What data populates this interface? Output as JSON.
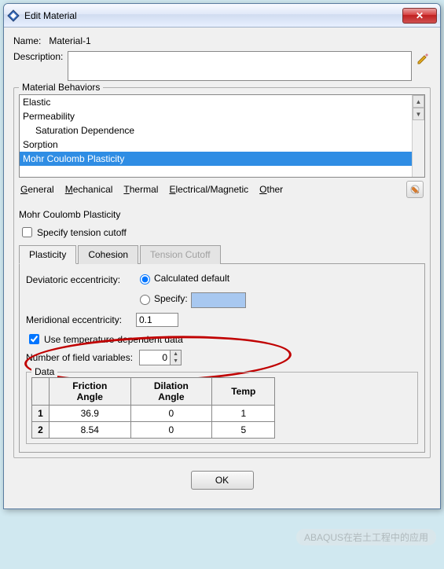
{
  "window": {
    "title": "Edit Material"
  },
  "name": {
    "label": "Name:",
    "value": "Material-1"
  },
  "description": {
    "label": "Description:",
    "value": ""
  },
  "behaviors": {
    "legend": "Material Behaviors",
    "items": [
      "Elastic",
      "Permeability",
      "Saturation Dependence",
      "Sorption",
      "Mohr Coulomb Plasticity"
    ],
    "selected_index": 4,
    "indented_indices": [
      2
    ]
  },
  "menus": {
    "general": [
      "G",
      "eneral"
    ],
    "mechanical": [
      "M",
      "echanical"
    ],
    "thermal": [
      "T",
      "hermal"
    ],
    "electrical": [
      "E",
      "lectrical/Magnetic"
    ],
    "other": [
      "O",
      "ther"
    ]
  },
  "section_title": "Mohr Coulomb Plasticity",
  "specify_tension_cutoff": {
    "label": "Specify tension cutoff",
    "checked": false
  },
  "tabs": [
    {
      "label": "Plasticity",
      "active": true,
      "disabled": false
    },
    {
      "label": "Cohesion",
      "active": false,
      "disabled": false
    },
    {
      "label": "Tension Cutoff",
      "active": false,
      "disabled": true
    }
  ],
  "plasticity": {
    "deviatoric_label": "Deviatoric eccentricity:",
    "radio_calculated": "Calculated default",
    "radio_specify": "Specify:",
    "radio_selected": "calculated",
    "meridional_label": "Meridional eccentricity:",
    "meridional_value": "0.1",
    "temp_dep": {
      "label": "Use temperature-dependent data",
      "checked": true
    },
    "field_vars_label": "Number of field variables:",
    "field_vars_value": "0",
    "data_legend": "Data",
    "columns": [
      "Friction\nAngle",
      "Dilation\nAngle",
      "Temp"
    ],
    "rows": [
      {
        "n": "1",
        "friction": "36.9",
        "dilation": "0",
        "temp": "1"
      },
      {
        "n": "2",
        "friction": "8.54",
        "dilation": "0",
        "temp": "5"
      }
    ]
  },
  "footer": {
    "ok": "OK"
  },
  "watermark": "ABAQUS在岩土工程中的应用",
  "chart_data": {
    "type": "table",
    "title": "Mohr Coulomb Plasticity Data",
    "columns": [
      "Friction Angle",
      "Dilation Angle",
      "Temp"
    ],
    "rows": [
      [
        36.9,
        0,
        1
      ],
      [
        8.54,
        0,
        5
      ]
    ]
  }
}
